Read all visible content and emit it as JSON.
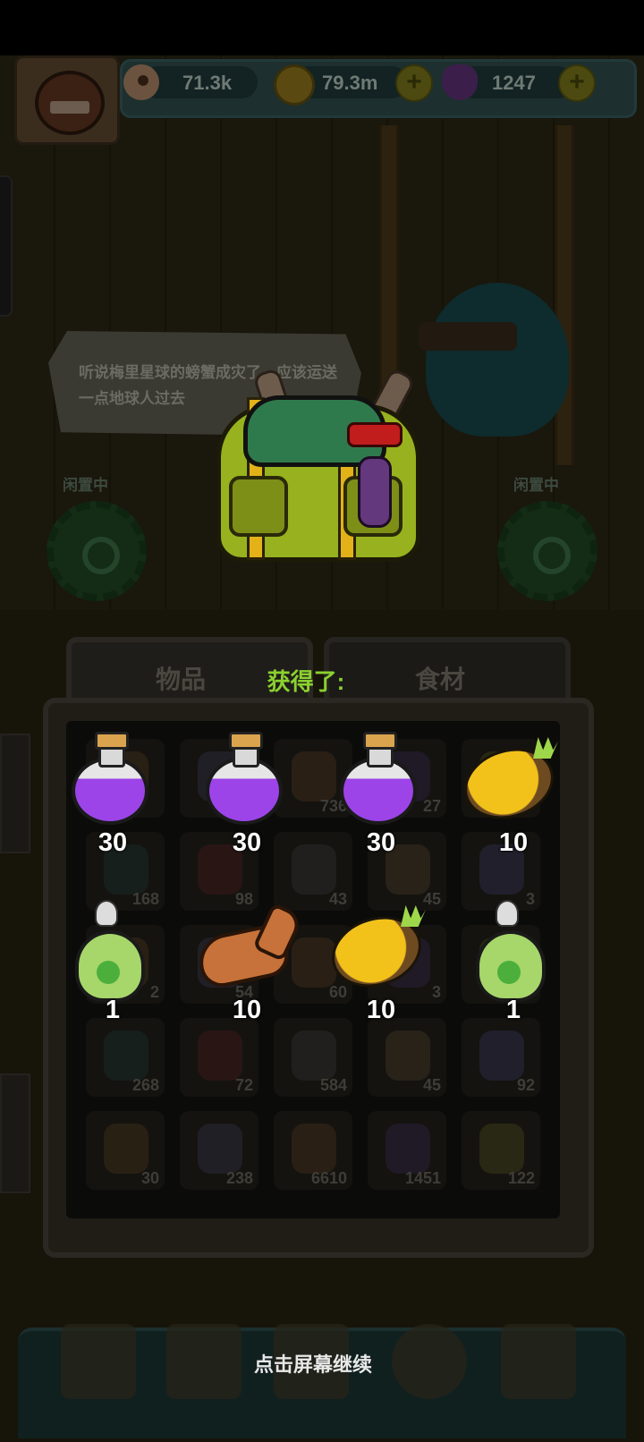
{
  "hud": {
    "eyes_value": "71.3k",
    "coins_value": "79.3m",
    "potion_value": "1247",
    "icons": {
      "eyes": "eyeball-icon",
      "coins": "coin-icon",
      "potion": "potion-icon",
      "plus": "plus-icon"
    }
  },
  "scene": {
    "speech_text": "听说梅里星球的螃蟹成灾了，应该运送一点地球人过去",
    "idle_left": "闲置中",
    "idle_right": "闲置中"
  },
  "inventory": {
    "tab_items": "物品",
    "tab_ingredients": "食材",
    "background_counts": [
      "",
      "",
      "736",
      "27",
      "",
      "168",
      "98",
      "43",
      "45",
      "3",
      "2",
      "54",
      "60",
      "3",
      "",
      "268",
      "72",
      "584",
      "45",
      "92",
      "30",
      "238",
      "6610",
      "1451",
      "122"
    ]
  },
  "reward": {
    "title": "获得了:",
    "items": [
      {
        "type": "potion",
        "icon": "purple-potion-icon",
        "count": "30"
      },
      {
        "type": "potion",
        "icon": "purple-potion-icon",
        "count": "30"
      },
      {
        "type": "potion",
        "icon": "purple-potion-icon",
        "count": "30"
      },
      {
        "type": "pineapple",
        "icon": "pineapple-icon",
        "count": "10"
      },
      {
        "type": "egg",
        "icon": "monster-egg-icon",
        "count": "1"
      },
      {
        "type": "fish",
        "icon": "roasted-fish-icon",
        "count": "10"
      },
      {
        "type": "pineapple",
        "icon": "pineapple-icon",
        "count": "10"
      },
      {
        "type": "egg",
        "icon": "monster-egg-icon",
        "count": "1"
      }
    ]
  },
  "footer": {
    "continue_text": "点击屏幕继续"
  },
  "colors": {
    "reward_title": "#8bd12f",
    "potion": "#9c44e8",
    "pineapple": "#f2c21b",
    "egg": "#a7d66a"
  }
}
